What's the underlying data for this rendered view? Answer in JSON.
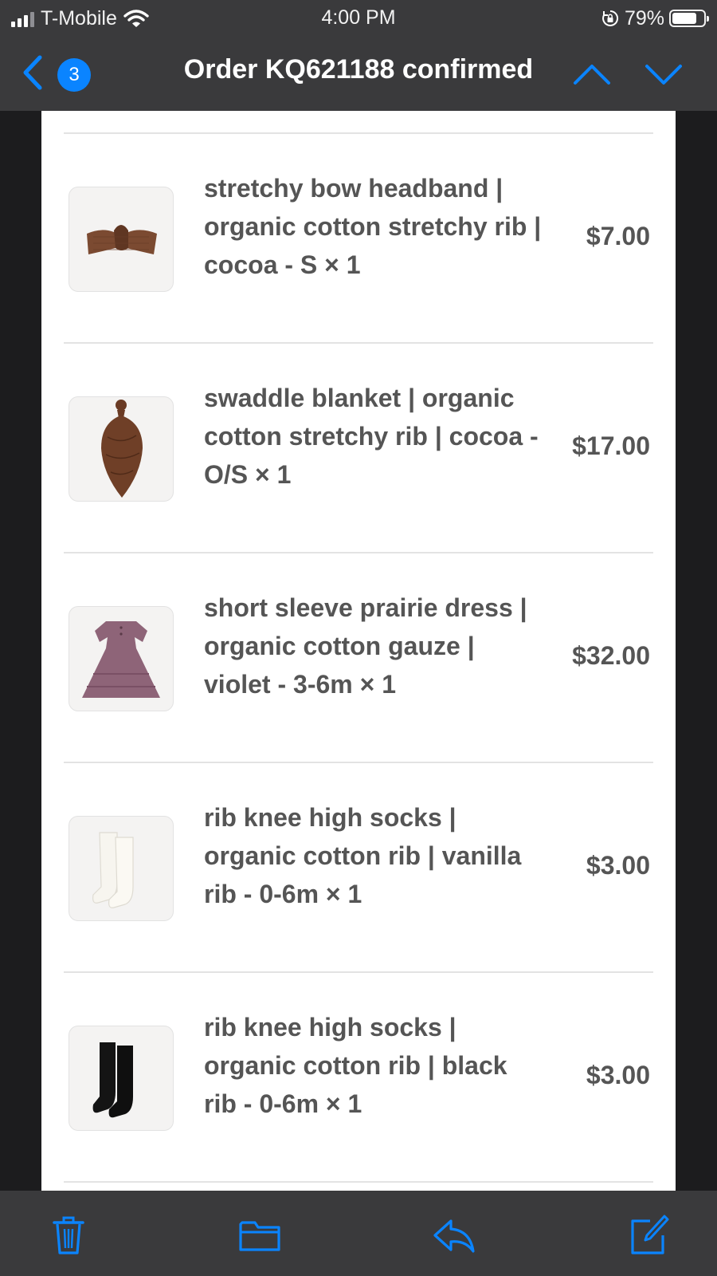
{
  "status_bar": {
    "carrier": "T-Mobile",
    "time": "4:00 PM",
    "battery_percent": "79%",
    "battery_level": 0.79,
    "icons": [
      "signal-icon",
      "wifi-icon",
      "rotation-lock-icon",
      "battery-icon"
    ]
  },
  "nav": {
    "back_icon": "chevron-left-icon",
    "unread_count": "3",
    "title": "Order KQ621188 confirmed",
    "prev_icon": "chevron-up-icon",
    "next_icon": "chevron-down-icon"
  },
  "items": [
    {
      "title": "stretchy bow headband | organic cotton stretchy rib | cocoa - S × 1",
      "price": "$7.00",
      "image": "headband-image"
    },
    {
      "title": "swaddle blanket | organic cotton stretchy rib | cocoa - O/S × 1",
      "price": "$17.00",
      "image": "swaddle-image"
    },
    {
      "title": "short sleeve prairie dress | organic cotton gauze | violet - 3-6m × 1",
      "price": "$32.00",
      "image": "dress-image"
    },
    {
      "title": "rib knee high socks | organic cotton rib | vanilla rib - 0-6m × 1",
      "price": "$3.00",
      "image": "white-socks-image"
    },
    {
      "title": "rib knee high socks | organic cotton rib | black rib - 0-6m × 1",
      "price": "$3.00",
      "image": "black-socks-image"
    }
  ],
  "toolbar": {
    "icons": [
      "trash-icon",
      "folder-icon",
      "reply-icon",
      "compose-icon"
    ]
  },
  "colors": {
    "accent": "#0a84ff",
    "bar_background": "#3a3a3c",
    "text": "#555555"
  }
}
